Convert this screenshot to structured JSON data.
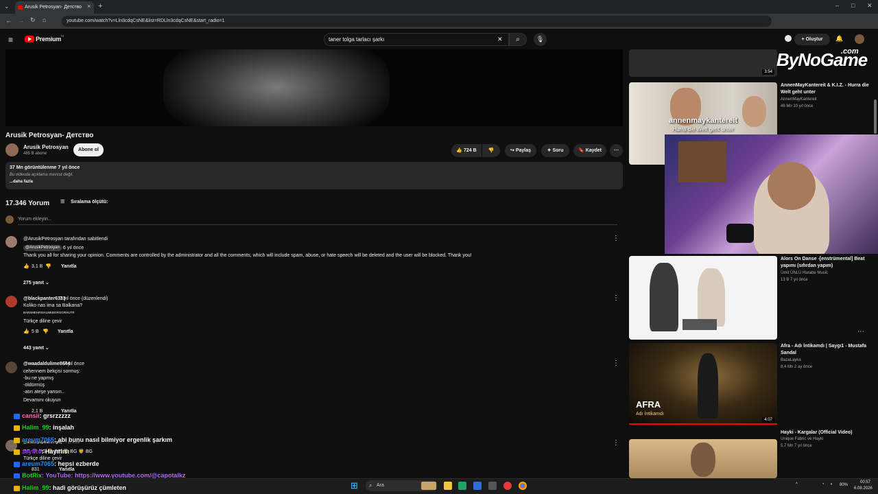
{
  "browser": {
    "tab_title": "Arusik Petrosyan- Детство",
    "url": "youtube.com/watch?v=Lln3cdqCsNE&list=RDLln3cdqCsNE&start_radio=1",
    "nav_glyphs": {
      "down": "⌄",
      "back": "←",
      "forward": "→",
      "reload": "↻",
      "home": "⌂",
      "close_tab": "×",
      "new_tab": "+",
      "minimize": "–",
      "maximize": "□",
      "close": "✕"
    }
  },
  "yt_header": {
    "brand": "Premium",
    "brand_sup": "TR",
    "search_value": "taner tolga tarlacı şarkı",
    "create_label": "Oluştur",
    "glyphs": {
      "menu": "≡",
      "clear": "✕",
      "search": "⌕",
      "mic": "🎙",
      "bell": "🔔"
    }
  },
  "video": {
    "title": "Arusik Petrosyan- Детство",
    "channel": "Arusik Petrosyan",
    "subscribers": "485 B abone",
    "subscribe_label": "Abone ol",
    "likes": "724 B",
    "share_label": "Paylaş",
    "ask_label": "Soru",
    "save_label": "Kaydet",
    "glyphs": {
      "like": "👍",
      "dislike": "👎",
      "share": "↪",
      "ask": "✦",
      "save": "🔖",
      "more": "⋯"
    }
  },
  "description": {
    "stats": "37 Mn görüntülenme  7 yıl önce",
    "text": "Bu videoda açıklama mevcut değil.",
    "more_label": "...daha fazla"
  },
  "comments": {
    "count_label": "17.346 Yorum",
    "sort_label": "Sıralama ölçütü:",
    "add_placeholder": "Yorum ekleyin...",
    "items": [
      {
        "pinned": "@ArusikPetrosyan tarafından sabitlendi",
        "author": "@ArusikPetrosyan",
        "time": "6 yıl önce",
        "text": "Thank you all for sharing your opinion. Comments are controlled by the administrator and all the comments, which will include spam, abuse, or hate speech will be deleted and the user will be blocked. Thank you!",
        "likes": "3,1 B",
        "reply_label": "Yanıtla",
        "replies": "275 yanıt"
      },
      {
        "author": "@blackpanter6333",
        "time": "7 yıl önce (düzenlendi)",
        "text": "Koliko nas ima sa Balkana?",
        "text2": "BARSMEHRSIALMKBGROGRHUTR",
        "translate": "Türkçe diline çevir",
        "likes": "5 B",
        "reply_label": "Yanıtla",
        "replies": "443 yanıt"
      },
      {
        "author": "@waadaldulime8644",
        "time": "7 yıl önce",
        "lines": [
          "cehennem bekçisi sormuş:",
          "-bu ne yapmış",
          "-öldürmüş",
          "-atın ateşe yansın.."
        ],
        "read_more": "Devamını okuyun",
        "likes": "2,1 B",
        "reply_label": "Yanıtla"
      },
      {
        "author": "@teodorpopivanov-g4q",
        "time": "7 yıl önce",
        "emoji_row": "BG 🦁 BG 🦁 BG 🦁 BG 🦁 BG",
        "translate": "Türkçe diline çevir",
        "likes": "831",
        "reply_label": "Yanıtla"
      }
    ]
  },
  "sidebar": {
    "videos": [
      {
        "title": "",
        "channel": "",
        "meta": "",
        "duration": "3:54"
      },
      {
        "title": "AnnenMayKantereit & K.I.Z. - Hurra die Welt geht unter",
        "channel": "AnnenMayKantereit",
        "meta": "46 Mn  10 yıl önce",
        "overlay1": "annenmaykantereit",
        "overlay2": "Hurra die Welt geht unter"
      },
      {
        "title": "Alors On Danse -[enstrümental] Beat yapımı (sıfırdan yapım)",
        "channel": "Ümit ÜNLÜ Harabe Music",
        "meta": "13 B  7 yıl önce"
      },
      {
        "title": "Afra - Adı İntikamdı | Saygı1 - Mustafa Sandal",
        "channel": "BazaLayka",
        "meta": "8,4 Mn  2 ay önce",
        "overlay1": "AFRA",
        "overlay2": "Adı İntikamdı",
        "duration": "4:07"
      },
      {
        "title": "Hayki - Kargalar (Official Video)",
        "channel": "Unique Fabric  ve Hayki",
        "meta": "5,7 Mn  7 yıl önce"
      }
    ],
    "more_glyph": "⋯"
  },
  "watermark": {
    "line1": "ByNoGame",
    "line2": ".com"
  },
  "chat": [
    {
      "user": "cansii",
      "msg": ": grsrzzzzz",
      "color": "#ff69b4"
    },
    {
      "user": "Halim_99",
      "msg": ": inşalah",
      "color": "#00e000"
    },
    {
      "user": "areum7065",
      "msg": ": abi bunu nasıl bilmiyor ergenlik şarkım",
      "color": "#1e90ff"
    },
    {
      "user": "zeyfito",
      "msg": ": Hayırlısı",
      "color": "#8a2be2"
    },
    {
      "user": "areum7065",
      "msg": ": hepsi ezberde",
      "color": "#1e90ff"
    },
    {
      "user": "BotRix",
      "msg": ": YouTube: https://www.youtube.com/@capotalkz",
      "color": "#00e000"
    },
    {
      "user": "Halim_99",
      "msg": ": hadi görüşürüz çümleten",
      "color": "#00e000"
    }
  ],
  "taskbar": {
    "search_label": "Ara",
    "time": "00:57",
    "date": "6.08.2026",
    "battery": "80%",
    "start_glyph": "⊞",
    "tray_glyphs": {
      "chevron": "^",
      "wifi": "◔",
      "volume": "◖"
    }
  }
}
